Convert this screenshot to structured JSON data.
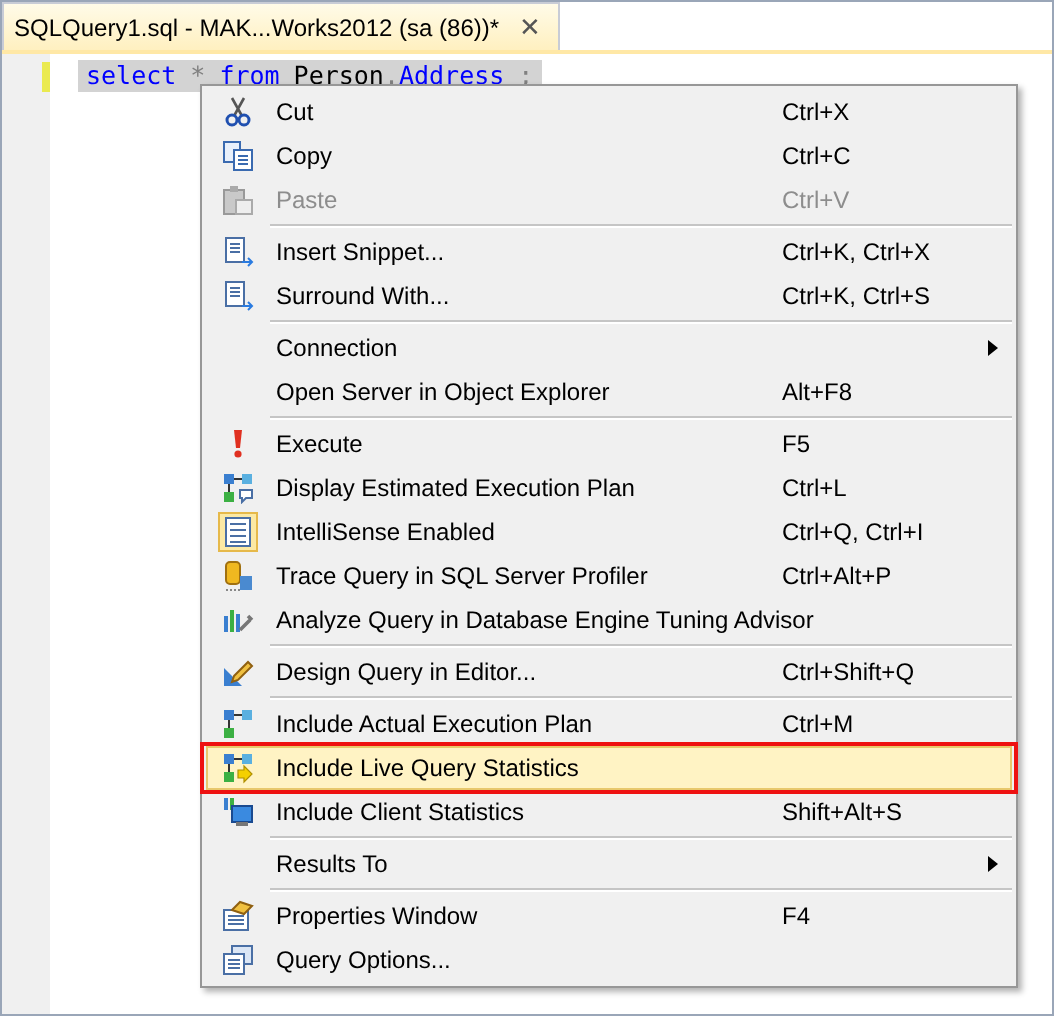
{
  "tab": {
    "title": "SQLQuery1.sql - MAK...Works2012 (sa (86))*",
    "close": "✕",
    "selected": true
  },
  "editor": {
    "tokens": [
      {
        "text": "select",
        "kind": "keyword"
      },
      {
        "text": "*",
        "kind": "operator"
      },
      {
        "text": "from",
        "kind": "keyword"
      },
      {
        "text": "Person",
        "kind": "identifier"
      },
      {
        "text": ".",
        "kind": "operator"
      },
      {
        "text": "Address",
        "kind": "keyword"
      },
      {
        "text": ";",
        "kind": "operator"
      }
    ]
  },
  "context_menu": {
    "items": [
      {
        "kind": "item",
        "label": "Cut",
        "shortcut": "Ctrl+X",
        "disabled": false,
        "checked": false,
        "selected": false,
        "highlighted": false,
        "submenu": false
      },
      {
        "kind": "item",
        "label": "Copy",
        "shortcut": "Ctrl+C",
        "disabled": false,
        "checked": false,
        "selected": false,
        "highlighted": false,
        "submenu": false
      },
      {
        "kind": "item",
        "label": "Paste",
        "shortcut": "Ctrl+V",
        "disabled": true,
        "checked": false,
        "selected": false,
        "highlighted": false,
        "submenu": false
      },
      {
        "kind": "separator"
      },
      {
        "kind": "item",
        "label": "Insert Snippet...",
        "shortcut": "Ctrl+K, Ctrl+X",
        "disabled": false,
        "checked": false,
        "selected": false,
        "highlighted": false,
        "submenu": false
      },
      {
        "kind": "item",
        "label": "Surround With...",
        "shortcut": "Ctrl+K, Ctrl+S",
        "disabled": false,
        "checked": false,
        "selected": false,
        "highlighted": false,
        "submenu": false
      },
      {
        "kind": "separator"
      },
      {
        "kind": "item",
        "label": "Connection",
        "disabled": false,
        "checked": false,
        "selected": false,
        "highlighted": false,
        "submenu": true
      },
      {
        "kind": "item",
        "label": "Open Server in Object Explorer",
        "shortcut": "Alt+F8",
        "disabled": false,
        "checked": false,
        "selected": false,
        "highlighted": false,
        "submenu": false
      },
      {
        "kind": "separator"
      },
      {
        "kind": "item",
        "label": "Execute",
        "shortcut": "F5",
        "disabled": false,
        "checked": false,
        "selected": false,
        "highlighted": false,
        "submenu": false
      },
      {
        "kind": "item",
        "label": "Display Estimated Execution Plan",
        "shortcut": "Ctrl+L",
        "disabled": false,
        "checked": false,
        "selected": false,
        "highlighted": false,
        "submenu": false
      },
      {
        "kind": "item",
        "label": "IntelliSense Enabled",
        "shortcut": "Ctrl+Q, Ctrl+I",
        "disabled": false,
        "checked": true,
        "selected": false,
        "highlighted": false,
        "submenu": false
      },
      {
        "kind": "item",
        "label": "Trace Query in SQL Server Profiler",
        "shortcut": "Ctrl+Alt+P",
        "disabled": false,
        "checked": false,
        "selected": false,
        "highlighted": false,
        "submenu": false
      },
      {
        "kind": "item",
        "label": "Analyze Query in Database Engine Tuning Advisor",
        "disabled": false,
        "checked": false,
        "selected": false,
        "highlighted": false,
        "submenu": false
      },
      {
        "kind": "separator"
      },
      {
        "kind": "item",
        "label": "Design Query in Editor...",
        "shortcut": "Ctrl+Shift+Q",
        "disabled": false,
        "checked": false,
        "selected": false,
        "highlighted": false,
        "submenu": false
      },
      {
        "kind": "separator"
      },
      {
        "kind": "item",
        "label": "Include Actual Execution Plan",
        "shortcut": "Ctrl+M",
        "disabled": false,
        "checked": false,
        "selected": false,
        "highlighted": false,
        "submenu": false
      },
      {
        "kind": "item",
        "label": "Include Live Query Statistics",
        "disabled": false,
        "checked": false,
        "selected": true,
        "highlighted": true,
        "submenu": false
      },
      {
        "kind": "item",
        "label": "Include Client Statistics",
        "shortcut": "Shift+Alt+S",
        "disabled": false,
        "checked": false,
        "selected": false,
        "highlighted": false,
        "submenu": false
      },
      {
        "kind": "separator"
      },
      {
        "kind": "item",
        "label": "Results To",
        "disabled": false,
        "checked": false,
        "selected": false,
        "highlighted": false,
        "submenu": true
      },
      {
        "kind": "separator"
      },
      {
        "kind": "item",
        "label": "Properties Window",
        "shortcut": "F4",
        "disabled": false,
        "checked": false,
        "selected": false,
        "highlighted": false,
        "submenu": false
      },
      {
        "kind": "item",
        "label": "Query Options...",
        "disabled": false,
        "checked": false,
        "selected": false,
        "highlighted": false,
        "submenu": false
      }
    ]
  }
}
